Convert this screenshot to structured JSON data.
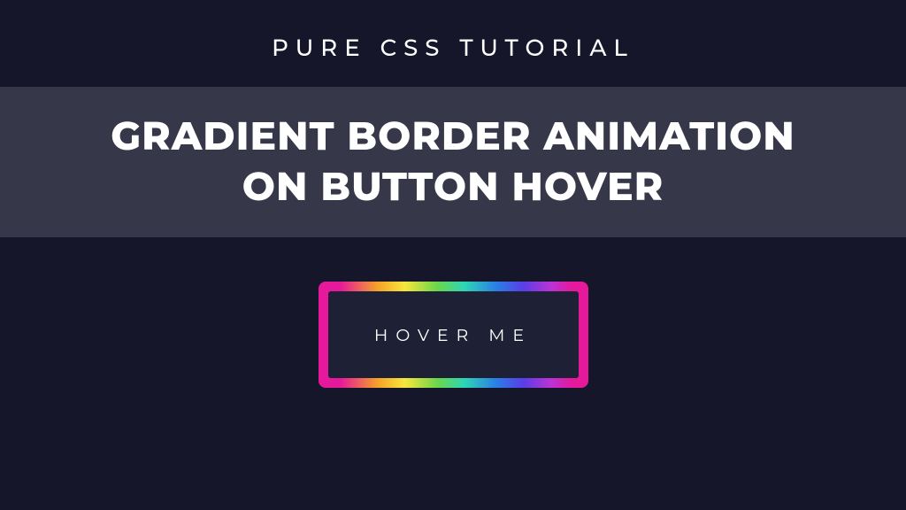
{
  "header": {
    "subtitle": "PURE CSS TUTORIAL",
    "title_line1": "GRADIENT BORDER ANIMATION",
    "title_line2": "ON BUTTON HOVER"
  },
  "button": {
    "label": "HOVER ME"
  }
}
